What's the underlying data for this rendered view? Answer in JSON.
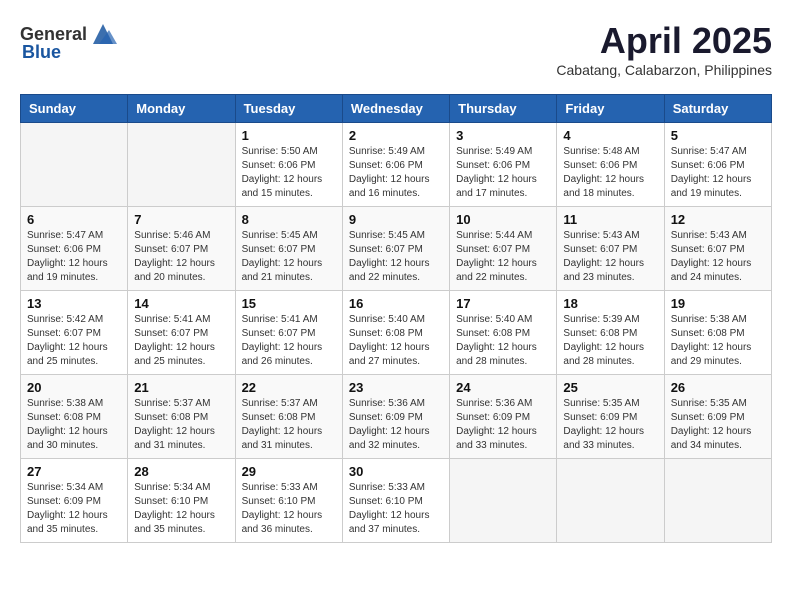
{
  "header": {
    "logo_general": "General",
    "logo_blue": "Blue",
    "month_title": "April 2025",
    "location": "Cabatang, Calabarzon, Philippines"
  },
  "weekdays": [
    "Sunday",
    "Monday",
    "Tuesday",
    "Wednesday",
    "Thursday",
    "Friday",
    "Saturday"
  ],
  "weeks": [
    [
      {
        "day": "",
        "info": ""
      },
      {
        "day": "",
        "info": ""
      },
      {
        "day": "1",
        "info": "Sunrise: 5:50 AM\nSunset: 6:06 PM\nDaylight: 12 hours and 15 minutes."
      },
      {
        "day": "2",
        "info": "Sunrise: 5:49 AM\nSunset: 6:06 PM\nDaylight: 12 hours and 16 minutes."
      },
      {
        "day": "3",
        "info": "Sunrise: 5:49 AM\nSunset: 6:06 PM\nDaylight: 12 hours and 17 minutes."
      },
      {
        "day": "4",
        "info": "Sunrise: 5:48 AM\nSunset: 6:06 PM\nDaylight: 12 hours and 18 minutes."
      },
      {
        "day": "5",
        "info": "Sunrise: 5:47 AM\nSunset: 6:06 PM\nDaylight: 12 hours and 19 minutes."
      }
    ],
    [
      {
        "day": "6",
        "info": "Sunrise: 5:47 AM\nSunset: 6:06 PM\nDaylight: 12 hours and 19 minutes."
      },
      {
        "day": "7",
        "info": "Sunrise: 5:46 AM\nSunset: 6:07 PM\nDaylight: 12 hours and 20 minutes."
      },
      {
        "day": "8",
        "info": "Sunrise: 5:45 AM\nSunset: 6:07 PM\nDaylight: 12 hours and 21 minutes."
      },
      {
        "day": "9",
        "info": "Sunrise: 5:45 AM\nSunset: 6:07 PM\nDaylight: 12 hours and 22 minutes."
      },
      {
        "day": "10",
        "info": "Sunrise: 5:44 AM\nSunset: 6:07 PM\nDaylight: 12 hours and 22 minutes."
      },
      {
        "day": "11",
        "info": "Sunrise: 5:43 AM\nSunset: 6:07 PM\nDaylight: 12 hours and 23 minutes."
      },
      {
        "day": "12",
        "info": "Sunrise: 5:43 AM\nSunset: 6:07 PM\nDaylight: 12 hours and 24 minutes."
      }
    ],
    [
      {
        "day": "13",
        "info": "Sunrise: 5:42 AM\nSunset: 6:07 PM\nDaylight: 12 hours and 25 minutes."
      },
      {
        "day": "14",
        "info": "Sunrise: 5:41 AM\nSunset: 6:07 PM\nDaylight: 12 hours and 25 minutes."
      },
      {
        "day": "15",
        "info": "Sunrise: 5:41 AM\nSunset: 6:07 PM\nDaylight: 12 hours and 26 minutes."
      },
      {
        "day": "16",
        "info": "Sunrise: 5:40 AM\nSunset: 6:08 PM\nDaylight: 12 hours and 27 minutes."
      },
      {
        "day": "17",
        "info": "Sunrise: 5:40 AM\nSunset: 6:08 PM\nDaylight: 12 hours and 28 minutes."
      },
      {
        "day": "18",
        "info": "Sunrise: 5:39 AM\nSunset: 6:08 PM\nDaylight: 12 hours and 28 minutes."
      },
      {
        "day": "19",
        "info": "Sunrise: 5:38 AM\nSunset: 6:08 PM\nDaylight: 12 hours and 29 minutes."
      }
    ],
    [
      {
        "day": "20",
        "info": "Sunrise: 5:38 AM\nSunset: 6:08 PM\nDaylight: 12 hours and 30 minutes."
      },
      {
        "day": "21",
        "info": "Sunrise: 5:37 AM\nSunset: 6:08 PM\nDaylight: 12 hours and 31 minutes."
      },
      {
        "day": "22",
        "info": "Sunrise: 5:37 AM\nSunset: 6:08 PM\nDaylight: 12 hours and 31 minutes."
      },
      {
        "day": "23",
        "info": "Sunrise: 5:36 AM\nSunset: 6:09 PM\nDaylight: 12 hours and 32 minutes."
      },
      {
        "day": "24",
        "info": "Sunrise: 5:36 AM\nSunset: 6:09 PM\nDaylight: 12 hours and 33 minutes."
      },
      {
        "day": "25",
        "info": "Sunrise: 5:35 AM\nSunset: 6:09 PM\nDaylight: 12 hours and 33 minutes."
      },
      {
        "day": "26",
        "info": "Sunrise: 5:35 AM\nSunset: 6:09 PM\nDaylight: 12 hours and 34 minutes."
      }
    ],
    [
      {
        "day": "27",
        "info": "Sunrise: 5:34 AM\nSunset: 6:09 PM\nDaylight: 12 hours and 35 minutes."
      },
      {
        "day": "28",
        "info": "Sunrise: 5:34 AM\nSunset: 6:10 PM\nDaylight: 12 hours and 35 minutes."
      },
      {
        "day": "29",
        "info": "Sunrise: 5:33 AM\nSunset: 6:10 PM\nDaylight: 12 hours and 36 minutes."
      },
      {
        "day": "30",
        "info": "Sunrise: 5:33 AM\nSunset: 6:10 PM\nDaylight: 12 hours and 37 minutes."
      },
      {
        "day": "",
        "info": ""
      },
      {
        "day": "",
        "info": ""
      },
      {
        "day": "",
        "info": ""
      }
    ]
  ]
}
